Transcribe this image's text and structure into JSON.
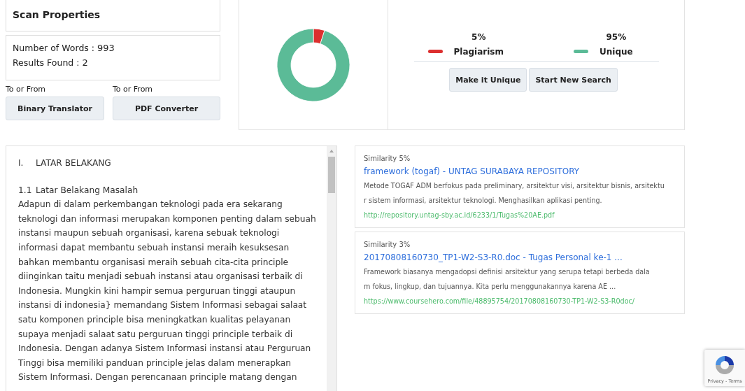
{
  "scan_properties": {
    "title": "Scan Properties",
    "words_label": "Number of Words :",
    "words_value": "993",
    "results_label": "Results Found :",
    "results_value": "2"
  },
  "tools": [
    {
      "caption": "To or From",
      "button": "Binary Translator"
    },
    {
      "caption": "To or From",
      "button": "PDF Converter"
    }
  ],
  "summary": {
    "chart_data": {
      "type": "donut",
      "categories": [
        "Plagiarism",
        "Unique"
      ],
      "values": [
        5,
        95
      ]
    },
    "legend": [
      {
        "value": "5%",
        "color": "#dc2f2f"
      },
      {
        "value": "95%",
        "color": "#5bbb97"
      }
    ],
    "buttons": [
      "Make it Unique",
      "Start New Search"
    ]
  },
  "document": {
    "lines": [
      {
        "kind": "heading",
        "number": "I.",
        "text": "LATAR BELAKANG"
      },
      {
        "kind": "heading",
        "number": "1.1",
        "text": "Latar Belakang Masalah"
      },
      {
        "kind": "body",
        "text": "Adapun di dalam perkembangan teknologi pada era sekarang"
      },
      {
        "kind": "body",
        "text": "teknologi dan informasi merupakan komponen penting dalam sebuah"
      },
      {
        "kind": "body",
        "text": "instansi maupun sebuah organisasi, karena sebuak teknologi"
      },
      {
        "kind": "body",
        "text": "informasi dapat membantu sebuah instansi meraih kesuksesan"
      },
      {
        "kind": "body",
        "text": "bahkan membantu organisasi meraih sebuah cita-cita principle"
      },
      {
        "kind": "body",
        "text": "diinginkan  taitu menjadi sebuah instansi atau organisasi terbaik di"
      },
      {
        "kind": "body",
        "text": "Indonesia. Mungkin kini hampir semua perguruan tinggi ataupun"
      },
      {
        "kind": "body",
        "text": "instansi di indonesia} memandang Sistem Informasi sebagai salaat"
      },
      {
        "kind": "body",
        "text": "satu komponen principle bisa meningkatkan kualitas pelayanan"
      },
      {
        "kind": "body",
        "text": "supaya menjadi salaat satu perguruan tinggi principle terbaik di"
      },
      {
        "kind": "body",
        "text": "Indonesia. Dengan adanya Sistem Informasi instansi atau Perguruan"
      },
      {
        "kind": "body",
        "text": "Tinggi bisa memiliki panduan principle jelas dalam menerapkan"
      },
      {
        "kind": "body",
        "text": "Sistem Informasi. Dengan perencanaan principle matang dengan"
      }
    ]
  },
  "results": [
    {
      "similarity": "Similarity 5%",
      "title": "framework (togaf) - UNTAG SURABAYA REPOSITORY",
      "description_lines": [
        "Metode TOGAF ADM berfokus pada preliminary, arsitektur visi, arsitektur bisnis, arsitektu",
        "r sistem informasi, arsitektur teknologi. Menghasilkan aplikasi penting."
      ],
      "url": "http://repository.untag-sby.ac.id/6233/1/Tugas%20AE.pdf"
    },
    {
      "similarity": "Similarity 3%",
      "title": "20170808160730_TP1-W2-S3-R0.doc - Tugas Personal ke-1 ...",
      "description_lines": [
        "Framework biasanya mengadopsi definisi arsitektur yang serupa tetapi berbeda dala",
        "m fokus, lingkup, dan tujuannya. Kita perlu menggunakannya karena AE ..."
      ],
      "url": "https://www.coursehero.com/file/48895754/20170808160730-TP1-W2-S3-R0doc/"
    }
  ],
  "captcha": {
    "links": "Privacy - Terms"
  }
}
